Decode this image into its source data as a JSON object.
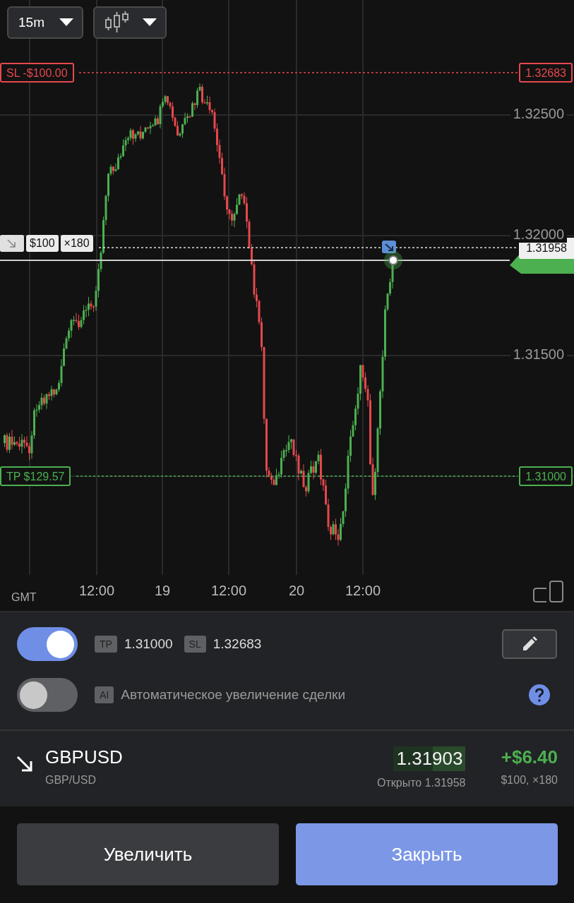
{
  "toolbar": {
    "timeframe": "15m"
  },
  "chart": {
    "stop_loss": {
      "label": "SL -$100.00",
      "price": "1.32683"
    },
    "take_profit": {
      "label": "TP $129.57",
      "price": "1.31000"
    },
    "entry": {
      "amount": "$100",
      "multiplier": "×180",
      "price": "1.31958"
    },
    "y_axis_labels": [
      "1.32500",
      "1.32000",
      "1.31500"
    ],
    "x_axis_labels": [
      "12:00",
      "19",
      "12:00",
      "20",
      "12:00"
    ],
    "timezone": "GMT"
  },
  "settings": {
    "tp_sl": {
      "on": true,
      "tp_badge": "TP",
      "tp_value": "1.31000",
      "sl_badge": "SL",
      "sl_value": "1.32683"
    },
    "auto_increase": {
      "on": false,
      "badge": "AI",
      "label": "Автоматическое увеличение сделки"
    }
  },
  "position": {
    "symbol": "GBPUSD",
    "pair": "GBP/USD",
    "price": "1.31903",
    "opened": "Открыто 1.31958",
    "profit": "+$6.40",
    "details": "$100, ×180"
  },
  "buttons": [
    {
      "label": "Увеличить",
      "kind": "secondary"
    },
    {
      "label": "Закрыть",
      "kind": "primary"
    }
  ]
}
